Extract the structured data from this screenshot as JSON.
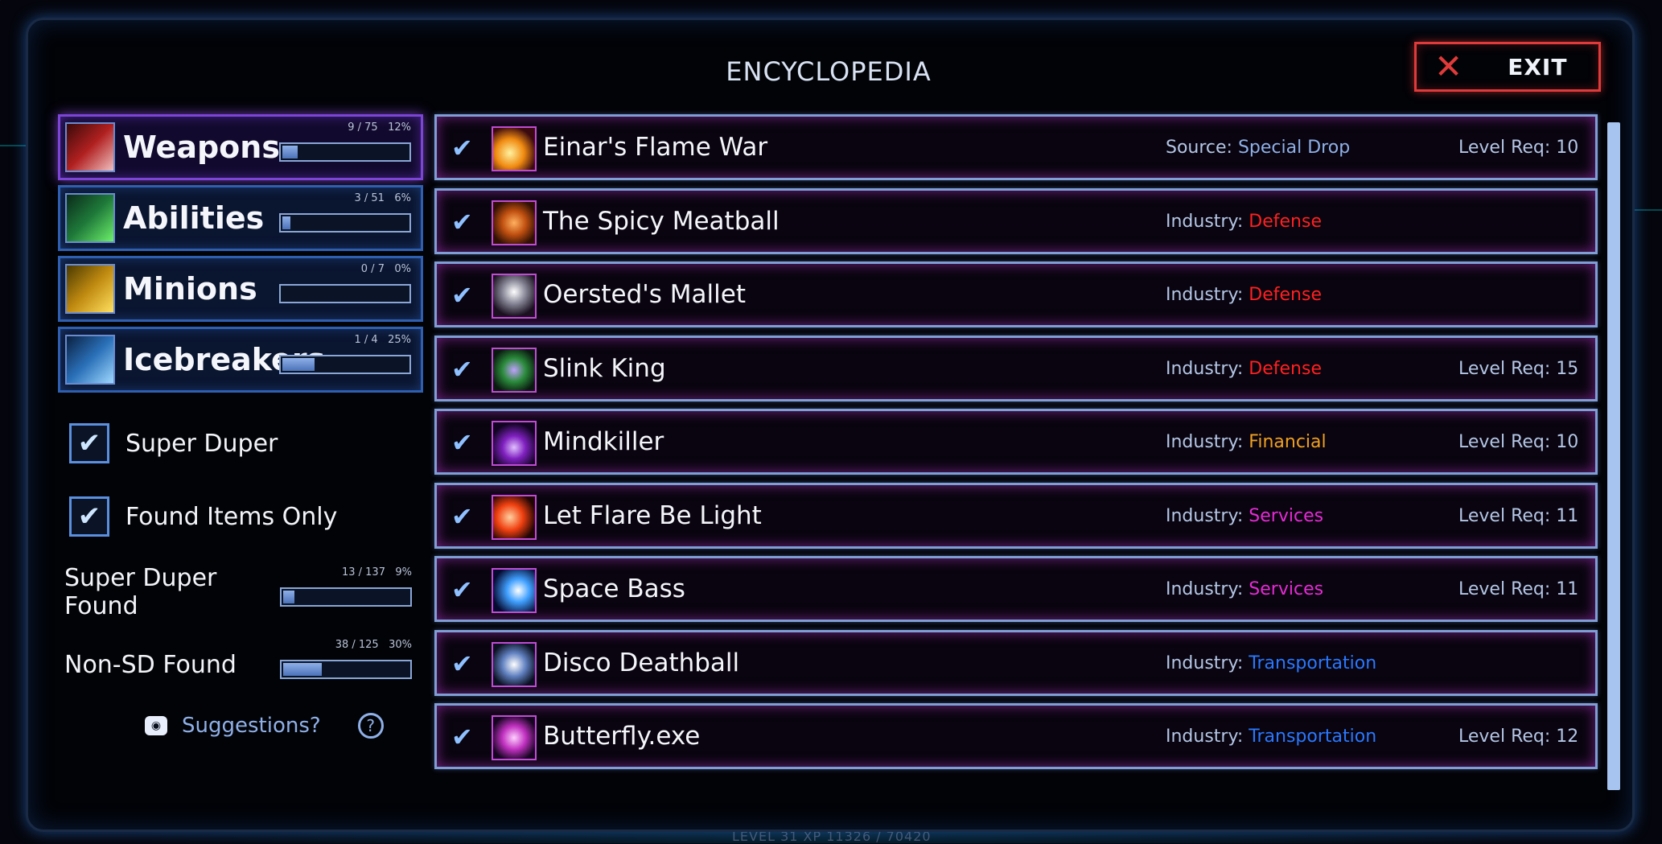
{
  "title": "ENCYCLOPEDIA",
  "exit_label": "EXIT",
  "colors": {
    "accent_blue": "#5b8fe0",
    "active_purple": "#7c45d6",
    "exit_red": "#e03a3a",
    "defense": "#ff2020",
    "financial": "#f0a020",
    "services": "#e62ad6",
    "transportation": "#2a78ff",
    "special_drop": "#8fb0e8"
  },
  "categories": [
    {
      "label": "Weapons",
      "count": "9 / 75",
      "pct": "12%",
      "progress": 0.12,
      "icon": "weapons-icon",
      "active": true
    },
    {
      "label": "Abilities",
      "count": "3 / 51",
      "pct": "6%",
      "progress": 0.06,
      "icon": "abilities-icon",
      "active": false
    },
    {
      "label": "Minions",
      "count": "0 / 7",
      "pct": "0%",
      "progress": 0.0,
      "icon": "minions-icon",
      "active": false
    },
    {
      "label": "Icebreakers",
      "count": "1 / 4",
      "pct": "25%",
      "progress": 0.25,
      "icon": "icebreakers-icon",
      "active": false
    }
  ],
  "filters": [
    {
      "label": "Super Duper",
      "checked": true
    },
    {
      "label": "Found Items Only",
      "checked": true
    }
  ],
  "stats": [
    {
      "label": "Super Duper Found",
      "count": "13 / 137",
      "pct": "9%",
      "progress": 0.09
    },
    {
      "label": "Non-SD Found",
      "count": "38 / 125",
      "pct": "30%",
      "progress": 0.3
    }
  ],
  "suggestions_label": "Suggestions?",
  "items": [
    {
      "name": "Einar's Flame War",
      "meta_key": "Source: ",
      "meta_val": "Special Drop",
      "meta_type": "special_drop",
      "level": "Level Req: 10",
      "found": true
    },
    {
      "name": "The Spicy Meatball",
      "meta_key": "Industry: ",
      "meta_val": "Defense",
      "meta_type": "defense",
      "level": "",
      "found": true
    },
    {
      "name": "Oersted's Mallet",
      "meta_key": "Industry: ",
      "meta_val": "Defense",
      "meta_type": "defense",
      "level": "",
      "found": true
    },
    {
      "name": "Slink King",
      "meta_key": "Industry: ",
      "meta_val": "Defense",
      "meta_type": "defense",
      "level": "Level Req: 15",
      "found": true
    },
    {
      "name": "Mindkiller",
      "meta_key": "Industry: ",
      "meta_val": "Financial",
      "meta_type": "financial",
      "level": "Level Req: 10",
      "found": true
    },
    {
      "name": "Let Flare Be Light",
      "meta_key": "Industry: ",
      "meta_val": "Services",
      "meta_type": "services",
      "level": "Level Req: 11",
      "found": true
    },
    {
      "name": "Space Bass",
      "meta_key": "Industry: ",
      "meta_val": "Services",
      "meta_type": "services",
      "level": "Level Req: 11",
      "found": true
    },
    {
      "name": "Disco Deathball",
      "meta_key": "Industry: ",
      "meta_val": "Transportation",
      "meta_type": "transportation",
      "level": "",
      "found": true
    },
    {
      "name": "Butterfly.exe",
      "meta_key": "Industry: ",
      "meta_val": "Transportation",
      "meta_type": "transportation",
      "level": "Level Req: 12",
      "found": true
    }
  ],
  "footer": "LEVEL 31    XP 11326 / 70420"
}
